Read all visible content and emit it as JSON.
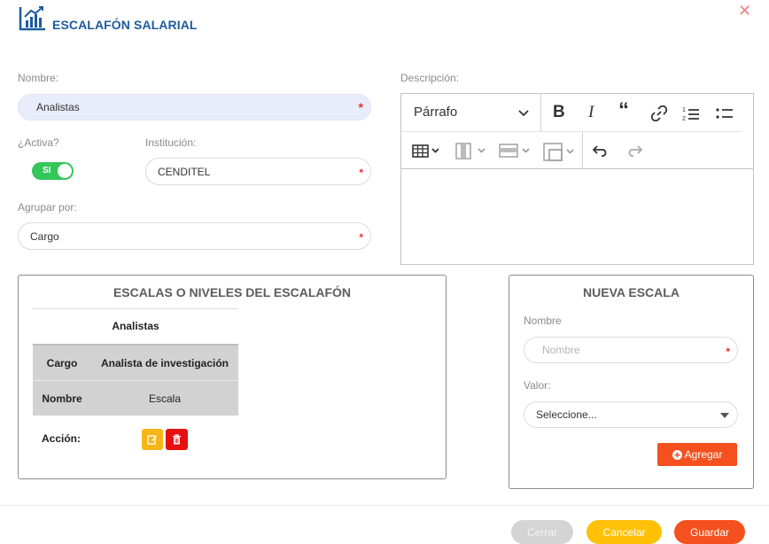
{
  "header": {
    "title": "ESCALAFÓN SALARIAL",
    "chart_icon": "chart-bars-icon",
    "close_icon": "close-icon",
    "close_glyph": "✕"
  },
  "form": {
    "nombre_label": "Nombre:",
    "nombre_value": "Analistas",
    "activa_label": "¿Activa?",
    "activa_toggle": "SI",
    "institucion_label": "Institución:",
    "institucion_value": "CENDITEL",
    "agrupar_label": "Agrupar por:",
    "agrupar_value": "Cargo",
    "descripcion_label": "Descripción:",
    "required_mark": "*"
  },
  "editor": {
    "heading_select": "Párrafo",
    "tools_row1": [
      "bold-icon",
      "italic-icon",
      "blockquote-icon",
      "link-icon",
      "numbered-list-icon",
      "bulleted-list-icon"
    ],
    "tools_row2": [
      "insert-table-icon",
      "table-column-icon",
      "table-row-icon",
      "merge-cells-icon",
      "undo-icon",
      "redo-icon"
    ]
  },
  "escalas": {
    "title": "ESCALAS O NIVELES DEL ESCALAFÓN",
    "group_name": "Analistas",
    "row1_label": "Cargo",
    "row1_value": "Analista de investigación",
    "row2_label": "Nombre",
    "row2_value": "Escala",
    "accion_label": "Acción:"
  },
  "nueva_escala": {
    "title": "NUEVA ESCALA",
    "nombre_label": "Nombre",
    "nombre_placeholder": "Nombre",
    "valor_label": "Valor:",
    "valor_value": "Seleccione...",
    "agregar_label": "Agregar"
  },
  "footer": {
    "cerrar": "Cerrar",
    "cancelar": "Cancelar",
    "guardar": "Guardar"
  },
  "colors": {
    "accent_blue": "#1e5b9e",
    "toggle_green": "#34c65a",
    "orange": "#f4511e",
    "yellow": "#ffc107",
    "red": "#e51010"
  }
}
